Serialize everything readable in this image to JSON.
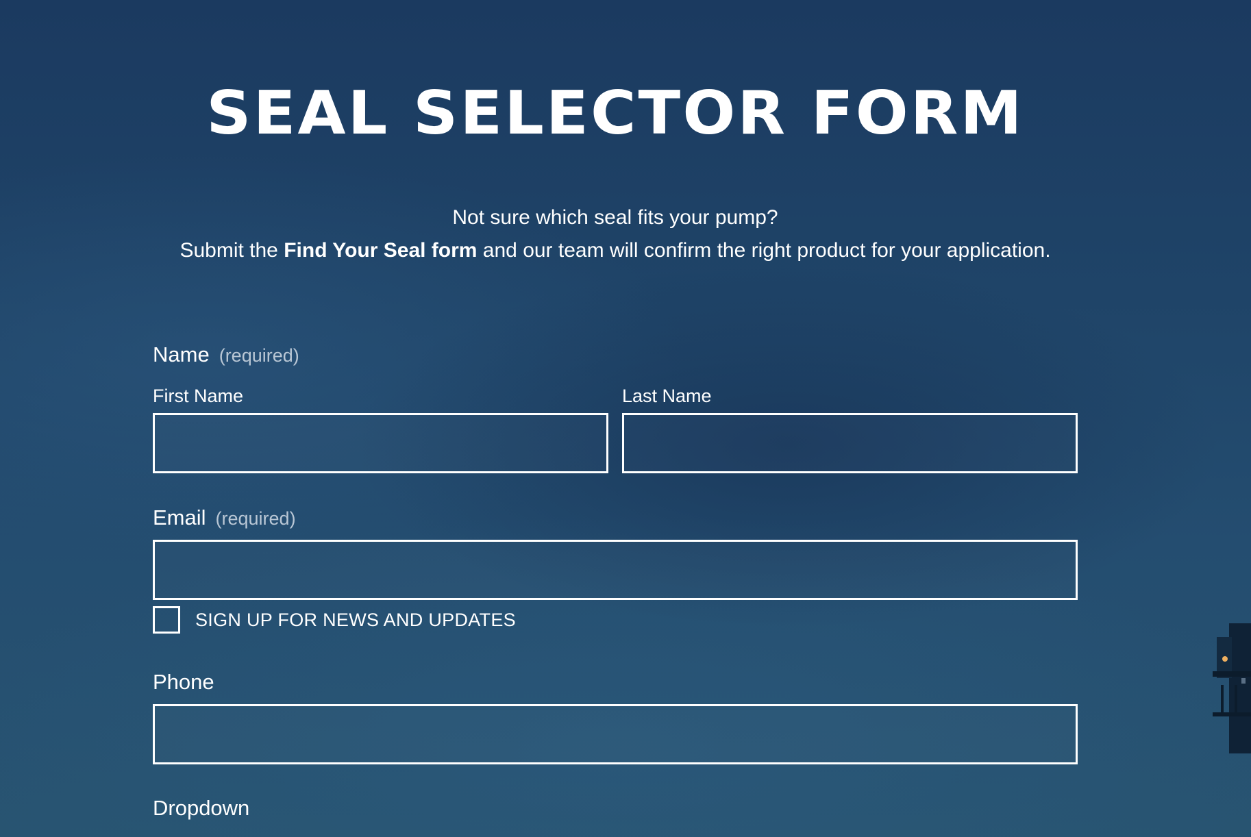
{
  "form": {
    "title": "SEAL SELECTOR FORM",
    "intro_line1": "Not sure which seal fits your pump?",
    "intro_line2_prefix": "Submit the ",
    "intro_line2_bold": "Find Your Seal form",
    "intro_line2_suffix": " and our team will confirm the right product for your application.",
    "name": {
      "label": "Name",
      "required": "(required)",
      "first_label": "First Name",
      "first_value": "",
      "last_label": "Last Name",
      "last_value": ""
    },
    "email": {
      "label": "Email",
      "required": "(required)",
      "value": "",
      "signup_label": "SIGN UP FOR NEWS AND UPDATES",
      "signup_checked": false
    },
    "phone": {
      "label": "Phone",
      "value": ""
    },
    "dropdown": {
      "label": "Dropdown"
    }
  },
  "colors": {
    "background": "#1f4468",
    "text": "#ffffff",
    "required_text": "#b9c7d5",
    "field_border": "#ffffff"
  }
}
